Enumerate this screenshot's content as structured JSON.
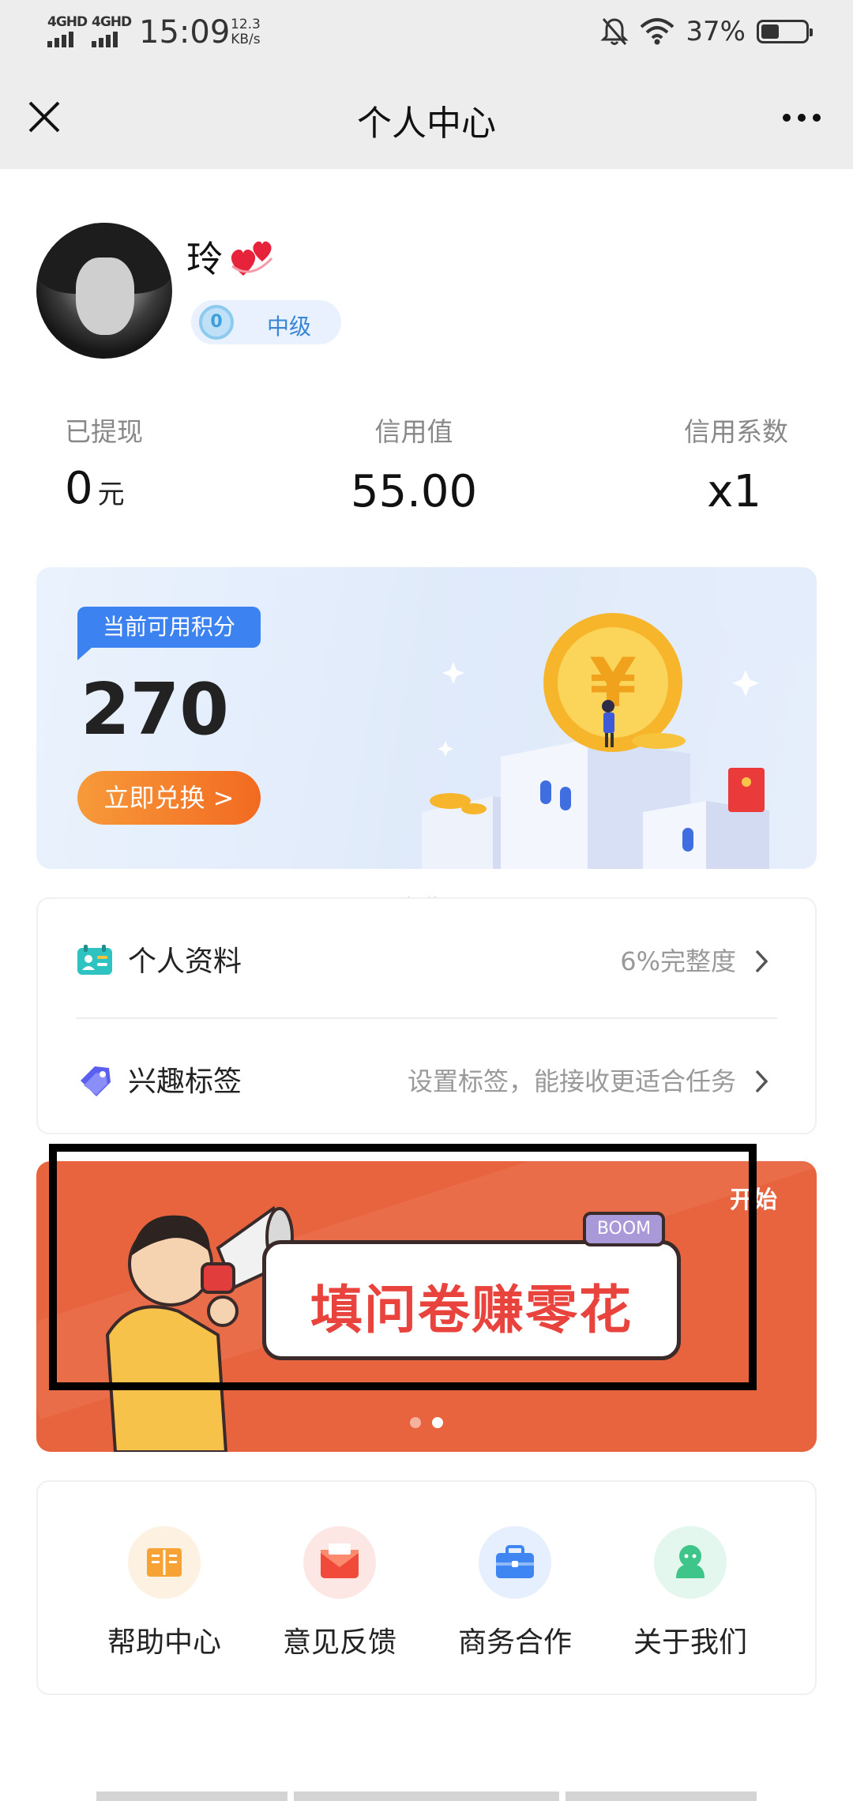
{
  "status_bar": {
    "signal1": "4GHD",
    "signal2": "4GHD",
    "time": "15:09",
    "speed_value": "12.3",
    "speed_unit": "KB/s",
    "battery_pct": "37%",
    "icons": [
      "silent-bell-icon",
      "wifi-icon",
      "battery-icon"
    ]
  },
  "title_bar": {
    "title": "个人中心",
    "close_icon": "close-icon",
    "more_icon": "more-dots-icon"
  },
  "profile": {
    "nickname": "玲",
    "emoji": "hearts-emoji",
    "level_badge": "0",
    "level": "中级"
  },
  "stats": [
    {
      "label": "已提现",
      "value": "0",
      "unit": "元"
    },
    {
      "label": "信用值",
      "value": "55.00"
    },
    {
      "label": "信用系数",
      "value": "x1"
    }
  ],
  "points": {
    "tag": "当前可用积分",
    "value": "270",
    "button": "立即兑换 >"
  },
  "watermark": "流量社区",
  "info_list": [
    {
      "label": "个人资料",
      "value": "6%完整度",
      "icon": "id-card-icon"
    },
    {
      "label": "兴趣标签",
      "value": "设置标签，能接收更适合任务",
      "icon": "tag-icon"
    }
  ],
  "banner": {
    "title": "填问卷赚零花",
    "boom": "BOOM",
    "corner": "开始",
    "active_slide": 2,
    "slide_count": 2
  },
  "menu": [
    {
      "label": "帮助中心",
      "icon": "book-icon",
      "color": "#f7a234",
      "bg": "#fdf1e2"
    },
    {
      "label": "意见反馈",
      "icon": "envelope-icon",
      "color": "#f24a3a",
      "bg": "#fde7e4"
    },
    {
      "label": "商务合作",
      "icon": "briefcase-icon",
      "color": "#3f86f2",
      "bg": "#e5effd"
    },
    {
      "label": "关于我们",
      "icon": "person-chat-icon",
      "color": "#3fc48a",
      "bg": "#e3f7ee"
    }
  ],
  "colors": {
    "accent_blue": "#3c82f0",
    "accent_orange": "#f26a21",
    "banner_bg": "#e8643e"
  }
}
